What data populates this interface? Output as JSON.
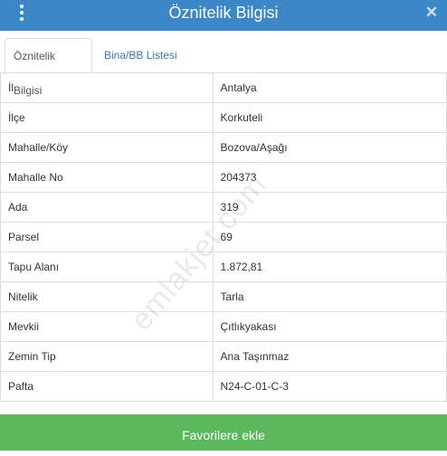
{
  "header": {
    "title": "Öznitelik Bilgisi"
  },
  "tabs": [
    {
      "label": "Öznitelik Bilgisi",
      "active": true
    },
    {
      "label": "Bina/BB Listesi",
      "active": false
    }
  ],
  "attributes": [
    {
      "key": "İl",
      "value": "Antalya"
    },
    {
      "key": "İlçe",
      "value": "Korkuteli"
    },
    {
      "key": "Mahalle/Köy",
      "value": "Bozova/Aşağı"
    },
    {
      "key": "Mahalle No",
      "value": "204373"
    },
    {
      "key": "Ada",
      "value": "319"
    },
    {
      "key": "Parsel",
      "value": "69"
    },
    {
      "key": "Tapu Alanı",
      "value": "1.872,81"
    },
    {
      "key": "Nitelik",
      "value": "Tarla"
    },
    {
      "key": "Mevkii",
      "value": "Çıtlıkyakası"
    },
    {
      "key": "Zemin Tip",
      "value": "Ana Taşınmaz"
    },
    {
      "key": "Pafta",
      "value": "N24-C-01-C-3"
    }
  ],
  "watermark": "emlakjet.com",
  "footer": {
    "button_label": "Favorilere ekle"
  },
  "colors": {
    "header": "#3b87c8",
    "tab_link": "#337ab7",
    "button": "#5cb85c"
  },
  "icons": {
    "menu": "kebab-menu-icon",
    "close": "close-icon"
  }
}
